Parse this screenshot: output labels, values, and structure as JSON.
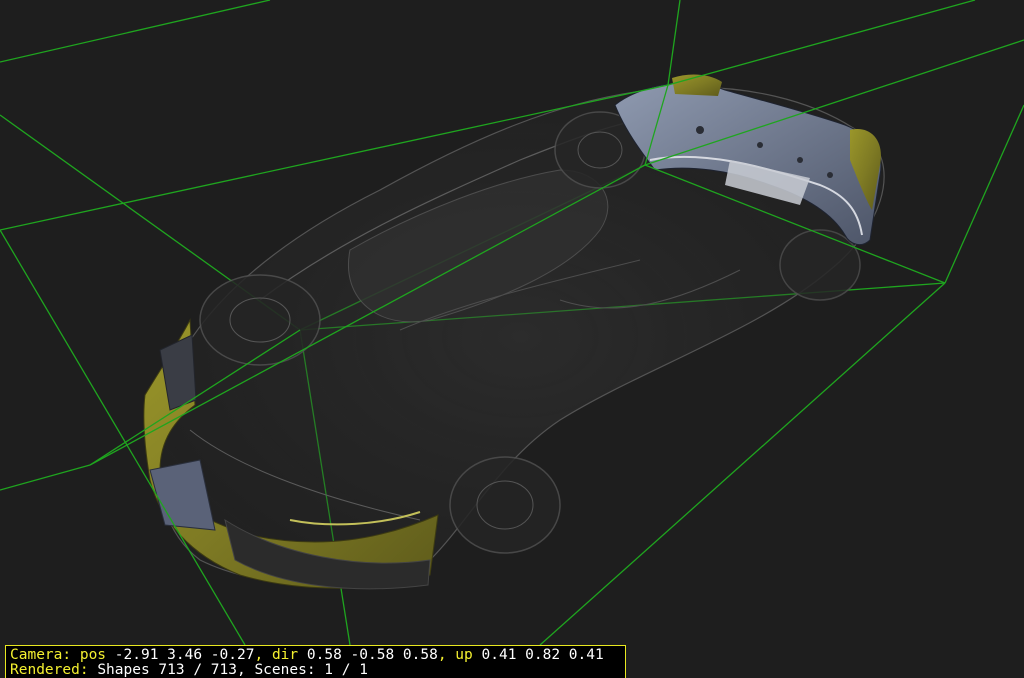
{
  "viewer": {
    "background_color": "#1e1e1e",
    "bounding_box_color": "#1fa51f",
    "highlight_color": "#a8a52c",
    "status_border_color": "#e8e820",
    "status_keyword_color": "#f4f030"
  },
  "status": {
    "camera_label": "Camera:",
    "pos_label": "pos",
    "pos_value": "-2.91 3.46 -0.27",
    "dir_label": "dir",
    "dir_value": "0.58 -0.58 0.58",
    "up_label": "up",
    "up_value": "0.41 0.82 0.41",
    "rendered_label": "Rendered:",
    "shapes_text": "Shapes 713 / 713, Scenes: 1 / 1"
  }
}
